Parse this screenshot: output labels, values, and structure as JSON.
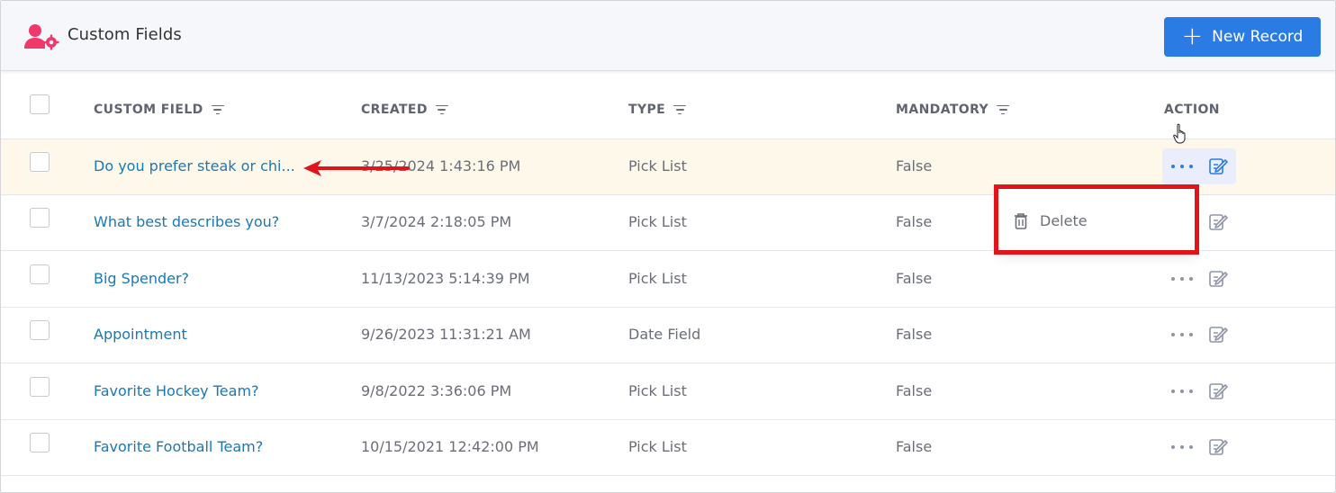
{
  "header": {
    "title": "Custom Fields",
    "new_button_label": "New Record",
    "new_button_icon": "plus-icon"
  },
  "table": {
    "columns": [
      "CUSTOM FIELD",
      "CREATED",
      "TYPE",
      "MANDATORY",
      "ACTION"
    ],
    "rows": [
      {
        "name": "Do you prefer steak or chi...",
        "created": "3/25/2024 1:43:16 PM",
        "type": "Pick List",
        "mandatory": "False"
      },
      {
        "name": "What best describes you?",
        "created": "3/7/2024 2:18:05 PM",
        "type": "Pick List",
        "mandatory": "False"
      },
      {
        "name": "Big Spender?",
        "created": "11/13/2023 5:14:39 PM",
        "type": "Pick List",
        "mandatory": "False"
      },
      {
        "name": "Appointment",
        "created": "9/26/2023 11:31:21 AM",
        "type": "Date Field",
        "mandatory": "False"
      },
      {
        "name": "Favorite Hockey Team?",
        "created": "9/8/2022 3:36:06 PM",
        "type": "Pick List",
        "mandatory": "False"
      },
      {
        "name": "Favorite Football Team?",
        "created": "10/15/2021 12:42:00 PM",
        "type": "Pick List",
        "mandatory": "False"
      }
    ]
  },
  "dropdown": {
    "delete_label": "Delete"
  },
  "colors": {
    "accent": "#2a7be4",
    "link": "#1879b8",
    "brand_icon": "#f0386b",
    "highlight_row": "#fef8ea",
    "annotation": "#e0141b"
  }
}
